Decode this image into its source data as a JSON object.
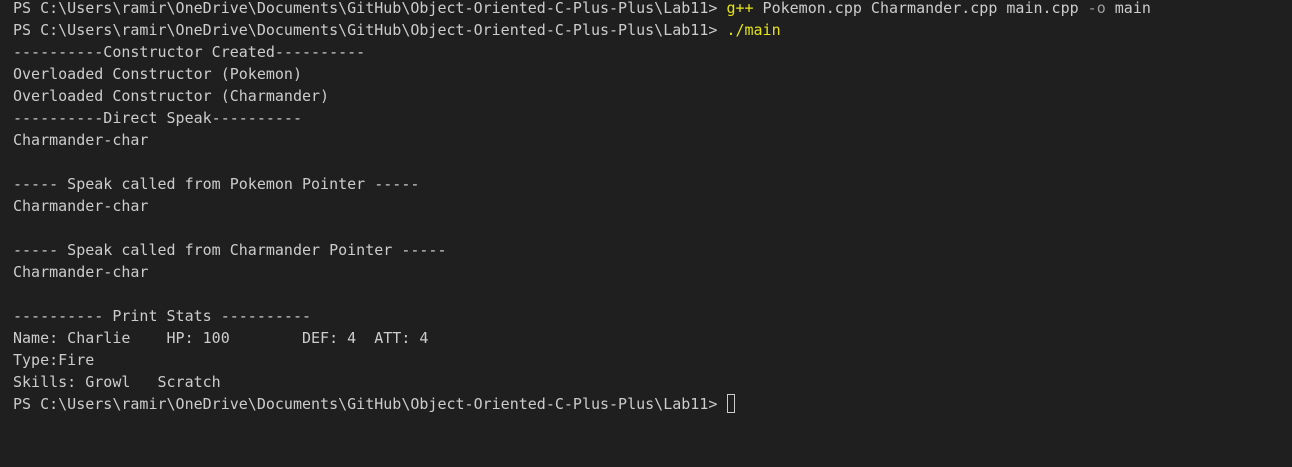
{
  "terminal": {
    "prompt": "PS C:\\Users\\ramir\\OneDrive\\Documents\\GitHub\\Object-Oriented-C-Plus-Plus\\Lab11> ",
    "cmd1": {
      "program": "g++",
      "args": " Pokemon.cpp Charmander.cpp main.cpp ",
      "flag": "-o",
      "output": " main"
    },
    "cmd2": {
      "program": "./main"
    },
    "output_lines": [
      "----------Constructor Created----------",
      "Overloaded Constructor (Pokemon)",
      "Overloaded Constructor (Charmander)",
      "----------Direct Speak----------",
      "Charmander-char",
      "",
      "----- Speak called from Pokemon Pointer -----",
      "Charmander-char",
      "",
      "----- Speak called from Charmander Pointer -----",
      "Charmander-char",
      "",
      "---------- Print Stats ----------",
      "Name: Charlie    HP: 100        DEF: 4  ATT: 4",
      "Type:Fire",
      "Skills: Growl   Scratch"
    ]
  }
}
